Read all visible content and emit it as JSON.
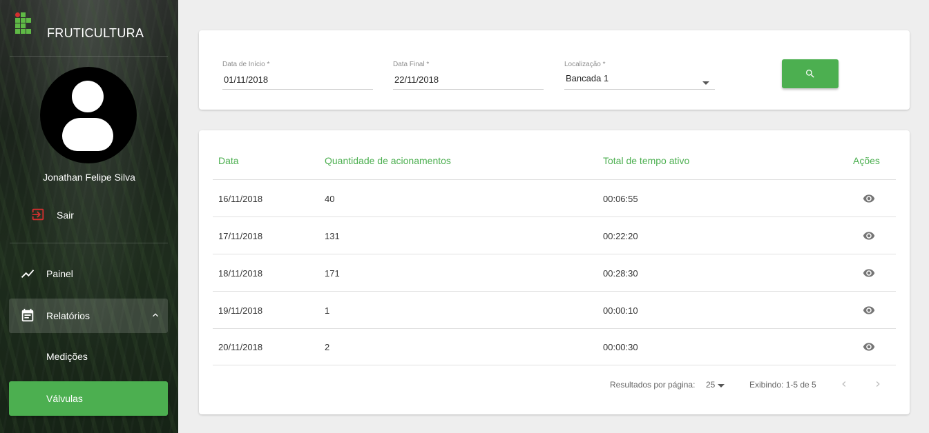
{
  "app": {
    "title": "FRUTICULTURA"
  },
  "user": {
    "name": "Jonathan Felipe Silva",
    "logout_label": "Sair"
  },
  "nav": {
    "painel": "Painel",
    "relatorios": "Relatórios",
    "medicoes": "Medições",
    "valvulas": "Válvulas"
  },
  "filters": {
    "start_label": "Data de Início *",
    "start_value": "01/11/2018",
    "end_label": "Data Final *",
    "end_value": "22/11/2018",
    "location_label": "Localização *",
    "location_value": "Bancada 1"
  },
  "table": {
    "headers": [
      "Data",
      "Quantidade de acionamentos",
      "Total de tempo ativo",
      "Ações"
    ],
    "rows": [
      [
        "16/11/2018",
        "40",
        "00:06:55"
      ],
      [
        "17/11/2018",
        "131",
        "00:22:20"
      ],
      [
        "18/11/2018",
        "171",
        "00:28:30"
      ],
      [
        "19/11/2018",
        "1",
        "00:00:10"
      ],
      [
        "20/11/2018",
        "2",
        "00:00:30"
      ]
    ]
  },
  "pagination": {
    "per_page_label": "Resultados por página:",
    "per_page_value": "25",
    "range_text": "Exibindo: 1-5 de 5"
  },
  "colors": {
    "accent": "#4caf50",
    "logout_icon": "#d32f2f"
  }
}
